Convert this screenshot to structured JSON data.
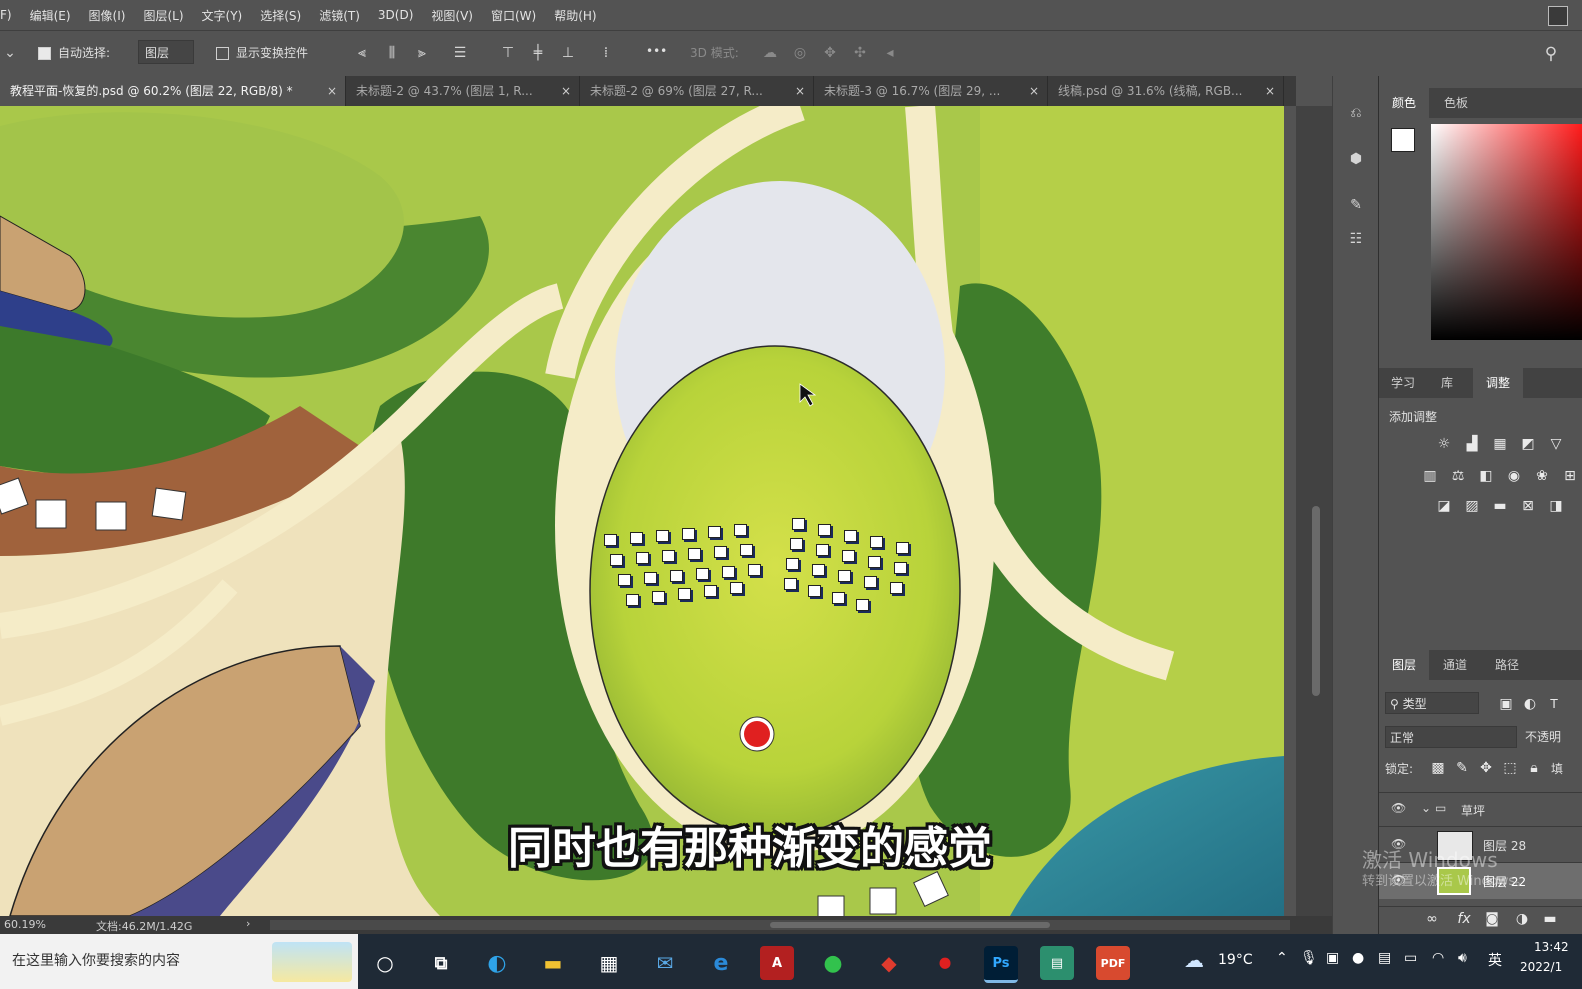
{
  "menu": [
    "F)",
    "编辑(E)",
    "图像(I)",
    "图层(L)",
    "文字(Y)",
    "选择(S)",
    "滤镜(T)",
    "3D(D)",
    "视图(V)",
    "窗口(W)",
    "帮助(H)"
  ],
  "options": {
    "auto_select_label": "自动选择:",
    "auto_select_value": "图层",
    "show_transform_label": "显示变换控件",
    "mode_3d_label": "3D 模式:",
    "more": "•••"
  },
  "tabs": [
    {
      "label": "教程平面-恢复的.psd @ 60.2% (图层 22, RGB/8) *",
      "close": "×"
    },
    {
      "label": "未标题-2 @ 43.7% (图层 1, R...",
      "close": "×"
    },
    {
      "label": "未标题-2 @ 69% (图层 27, R...",
      "close": "×"
    },
    {
      "label": "未标题-3 @ 16.7% (图层 29, ...",
      "close": "×"
    },
    {
      "label": "线稿.psd @ 31.6% (线稿, RGB...",
      "close": "×"
    }
  ],
  "status": {
    "zoom": "60.19%",
    "doc": "文档:46.2M/1.42G",
    "arrow": "›"
  },
  "color_panel": {
    "tabs": [
      "颜色",
      "色板"
    ]
  },
  "adjust_panel": {
    "tabs": [
      "学习",
      "库",
      "调整"
    ],
    "title": "添加调整"
  },
  "layers_panel": {
    "tabs": [
      "图层",
      "通道",
      "路径"
    ],
    "filter": "类型",
    "blend_mode": "正常",
    "opacity_label": "不透明",
    "lock_label": "锁定:",
    "fill_label": "填",
    "group_name": "草坪",
    "layers": [
      "图层 28",
      "图层 22"
    ]
  },
  "subtitle": "同时也有那种渐变的感觉",
  "watermark": {
    "line1": "激活 Windows",
    "line2": "转到设置以激活 Windows。"
  },
  "taskbar": {
    "search_placeholder": "在这里输入你要搜索的内容",
    "weather": "19°C",
    "ime": "英",
    "time": "13:42",
    "date": "2022/1"
  },
  "colors": {
    "accent": "#31a8ff",
    "canvas_grass": "#9fc43a",
    "water": "#2d8a9b",
    "red_marker": "#e02020"
  }
}
